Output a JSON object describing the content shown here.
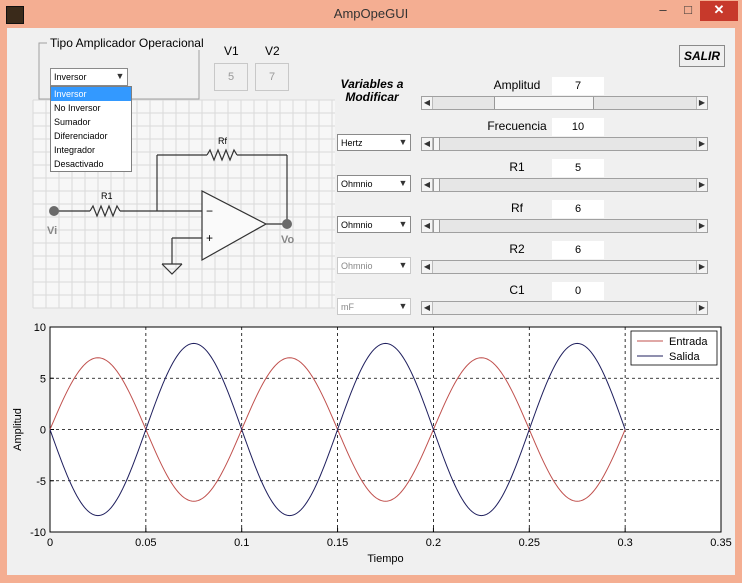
{
  "window": {
    "title": "AmpOpeGUI",
    "min": "–",
    "max": "□",
    "close": "✕"
  },
  "panel_title": "Tipo Amplicador Operacional",
  "op_select": {
    "value": "Inversor",
    "options": [
      "Inversor",
      "No Inversor",
      "Sumador",
      "Diferenciador",
      "Integrador",
      "Desactivado"
    ]
  },
  "v1": {
    "label": "V1",
    "value": "5"
  },
  "v2": {
    "label": "V2",
    "value": "7"
  },
  "salir": "SALIR",
  "vars_title": "Variables a Modificar",
  "circuit": {
    "rf": "Rf",
    "r1": "R1",
    "vi": "Vi",
    "vo": "Vo",
    "minus": "−",
    "plus": "+"
  },
  "controls": [
    {
      "label": "Amplitud",
      "value": "7",
      "thumb_fraction": 0.37,
      "unit": null,
      "enabled": true
    },
    {
      "label": "Frecuencia",
      "value": "10",
      "thumb_fraction": 0.0,
      "unit": "Hertz",
      "enabled": true
    },
    {
      "label": "R1",
      "value": "5",
      "thumb_fraction": 0.0,
      "unit": "Ohmnio",
      "enabled": true
    },
    {
      "label": "Rf",
      "value": "6",
      "thumb_fraction": 0.0,
      "unit": "Ohmnio",
      "enabled": true
    },
    {
      "label": "R2",
      "value": "6",
      "thumb_fraction": null,
      "unit": "Ohmnio",
      "enabled": false
    },
    {
      "label": "C1",
      "value": "0",
      "thumb_fraction": null,
      "unit": "mF",
      "enabled": false
    }
  ],
  "chart_data": {
    "type": "line",
    "xlabel": "Tiempo",
    "ylabel": "Amplitud",
    "xlim": [
      0,
      0.35
    ],
    "ylim": [
      -10,
      10
    ],
    "xticks": [
      "0",
      "0.05",
      "0.1",
      "0.15",
      "0.2",
      "0.25",
      "0.3",
      "0.35"
    ],
    "yticks": [
      "10",
      "5",
      "0",
      "-5",
      "-10"
    ],
    "grid": true,
    "legend_position": "top-right",
    "series": [
      {
        "name": "Entrada",
        "color": "#c0504d",
        "amplitude": 7,
        "frequency_hz": 10,
        "phase_sign": 1,
        "x_end": 0.3
      },
      {
        "name": "Salida",
        "color": "#1f1f5e",
        "amplitude": 8.4,
        "frequency_hz": 10,
        "phase_sign": -1,
        "x_end": 0.3
      }
    ]
  }
}
